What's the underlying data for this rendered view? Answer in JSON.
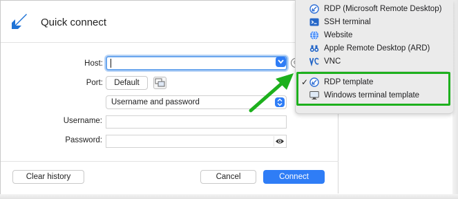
{
  "dialog": {
    "title": "Quick connect",
    "host_label": "Host:",
    "host_value": "",
    "port_label": "Port:",
    "port_default_label": "Default",
    "auth_method": "Username and password",
    "username_label": "Username:",
    "username_value": "",
    "password_label": "Password:",
    "password_value": ""
  },
  "footer": {
    "clear_history_label": "Clear history",
    "cancel_label": "Cancel",
    "connect_label": "Connect"
  },
  "menu": {
    "items": [
      {
        "label": "RDP (Microsoft Remote Desktop)",
        "icon": "rdp-icon"
      },
      {
        "label": "SSH terminal",
        "icon": "ssh-terminal-icon"
      },
      {
        "label": "Website",
        "icon": "globe-icon"
      },
      {
        "label": "Apple Remote Desktop (ARD)",
        "icon": "binoculars-icon"
      },
      {
        "label": "VNC",
        "icon": "vnc-icon"
      }
    ],
    "templates": [
      {
        "label": "RDP template",
        "icon": "rdp-icon",
        "checked": true
      },
      {
        "label": "Windows terminal template",
        "icon": "monitor-icon",
        "checked": false
      }
    ],
    "check_mark": "✓"
  },
  "colors": {
    "accent": "#2f7df6",
    "highlight": "#1db01d"
  }
}
